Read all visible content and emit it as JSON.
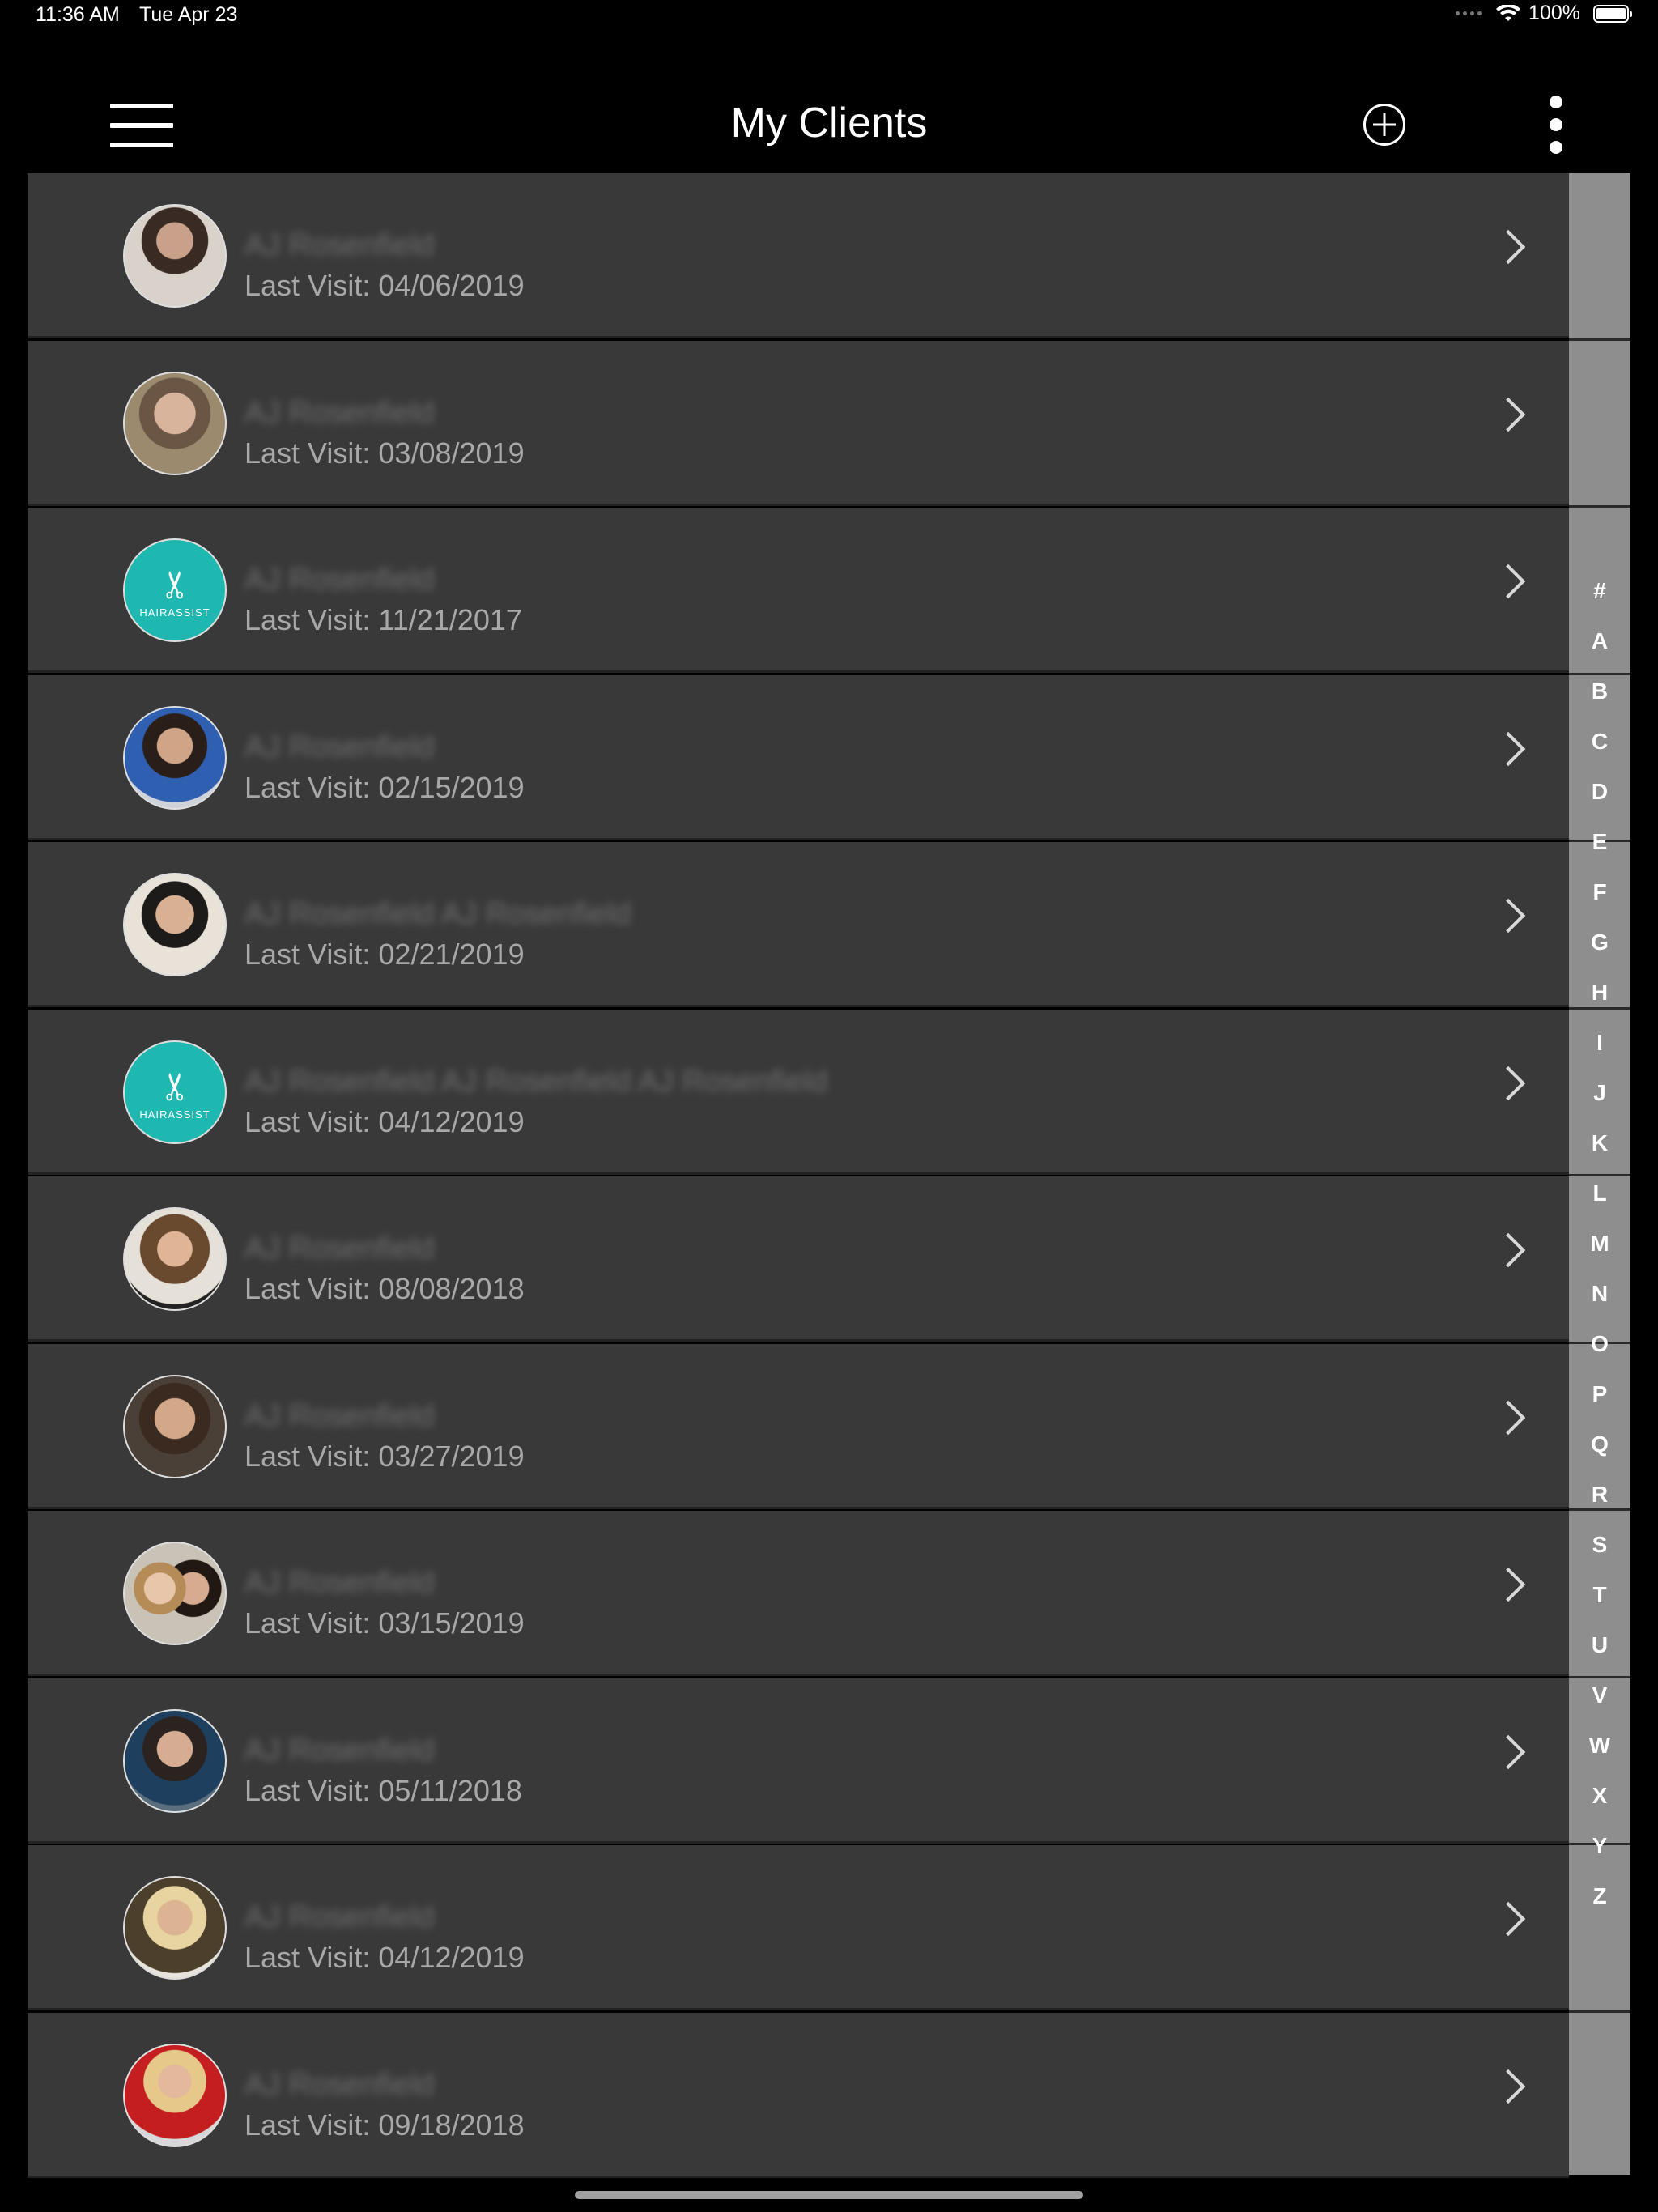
{
  "status_bar": {
    "time": "11:36 AM",
    "date": "Tue Apr 23",
    "battery": "100%"
  },
  "nav": {
    "title": "My Clients",
    "menu_icon": "hamburger-menu-icon",
    "add_icon": "add-circle-icon",
    "more_icon": "more-vertical-icon"
  },
  "clients": [
    {
      "name": "AJ Rosenfield",
      "last_visit": "Last Visit: 04/06/2019",
      "avatar": "photo"
    },
    {
      "name": "AJ Rosenfield",
      "last_visit": "Last Visit: 03/08/2019",
      "avatar": "photo2"
    },
    {
      "name": "AJ Rosenfield",
      "last_visit": "Last Visit: 11/21/2017",
      "avatar": "brand"
    },
    {
      "name": "AJ Rosenfield",
      "last_visit": "Last Visit: 02/15/2019",
      "avatar": "photo3"
    },
    {
      "name": "AJ Rosenfield AJ Rosenfield",
      "last_visit": "Last Visit: 02/21/2019",
      "avatar": "photo4"
    },
    {
      "name": "AJ Rosenfield AJ Rosenfield AJ Rosenfield",
      "last_visit": "Last Visit: 04/12/2019",
      "avatar": "brand"
    },
    {
      "name": "AJ Rosenfield",
      "last_visit": "Last Visit: 08/08/2018",
      "avatar": "photo5"
    },
    {
      "name": "AJ Rosenfield",
      "last_visit": "Last Visit: 03/27/2019",
      "avatar": "photo6"
    },
    {
      "name": "AJ Rosenfield",
      "last_visit": "Last Visit: 03/15/2019",
      "avatar": "photo7"
    },
    {
      "name": "AJ Rosenfield",
      "last_visit": "Last Visit: 05/11/2018",
      "avatar": "photo8"
    },
    {
      "name": "AJ Rosenfield",
      "last_visit": "Last Visit: 04/12/2019",
      "avatar": "photo9"
    },
    {
      "name": "AJ Rosenfield",
      "last_visit": "Last Visit: 09/18/2018",
      "avatar": "photo10"
    }
  ],
  "brand_avatar": {
    "text": "HAIRASSIST",
    "color": "#1fb8b0"
  },
  "alpha_index": [
    "#",
    "A",
    "B",
    "C",
    "D",
    "E",
    "F",
    "G",
    "H",
    "I",
    "J",
    "K",
    "L",
    "M",
    "N",
    "O",
    "P",
    "Q",
    "R",
    "S",
    "T",
    "U",
    "V",
    "W",
    "X",
    "Y",
    "Z"
  ],
  "colors": {
    "background": "#000000",
    "row": "#393939",
    "index_bar": "#8e8e8e",
    "accent": "#1fb8b0"
  }
}
